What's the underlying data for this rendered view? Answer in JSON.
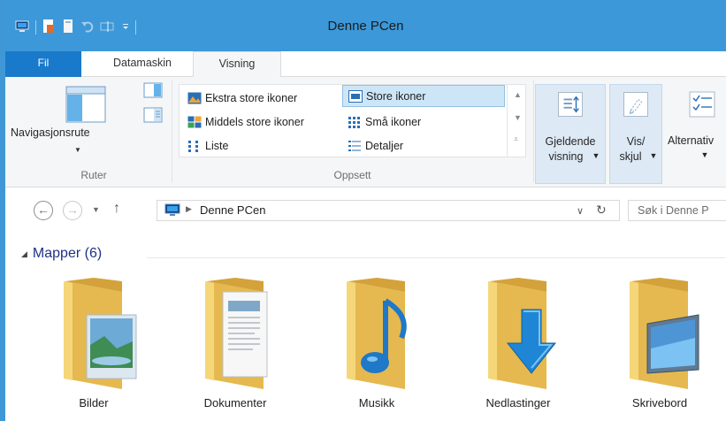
{
  "window": {
    "title": "Denne PCen"
  },
  "tabs": {
    "file": "Fil",
    "items": [
      {
        "label": "Datamaskin"
      },
      {
        "label": "Visning"
      }
    ],
    "active": "Visning"
  },
  "ribbon": {
    "panes_group": {
      "label": "Ruter",
      "navigation_pane": "Navigasjonsrute"
    },
    "layout_group": {
      "label": "Oppsett",
      "options": [
        {
          "label": "Ekstra store ikoner",
          "icon": "extra-large-icons-icon"
        },
        {
          "label": "Store ikoner",
          "icon": "large-icons-icon",
          "selected": true
        },
        {
          "label": "Middels store ikoner",
          "icon": "medium-icons-icon"
        },
        {
          "label": "Små ikoner",
          "icon": "small-icons-icon"
        },
        {
          "label": "Liste",
          "icon": "list-icon"
        },
        {
          "label": "Detaljer",
          "icon": "details-icon"
        }
      ]
    },
    "current_view": {
      "line1": "Gjeldende",
      "line2": "visning"
    },
    "show_hide": {
      "line1": "Vis/",
      "line2": "skjul"
    },
    "options": {
      "label": "Alternativ"
    }
  },
  "address": {
    "location": "Denne PCen",
    "search_placeholder": "Søk i Denne P"
  },
  "content": {
    "section_title": "Mapper (6)",
    "folders": [
      {
        "label": "Bilder",
        "icon": "pictures-folder-icon"
      },
      {
        "label": "Dokumenter",
        "icon": "documents-folder-icon"
      },
      {
        "label": "Musikk",
        "icon": "music-folder-icon"
      },
      {
        "label": "Nedlastinger",
        "icon": "downloads-folder-icon"
      },
      {
        "label": "Skrivebord",
        "icon": "desktop-folder-icon"
      }
    ]
  },
  "colors": {
    "titlebar": "#3c98d8",
    "file_tab": "#1979ca",
    "selection": "#cde6f7",
    "section_title": "#1e3287",
    "folder_yellow": "#f5d77a"
  }
}
